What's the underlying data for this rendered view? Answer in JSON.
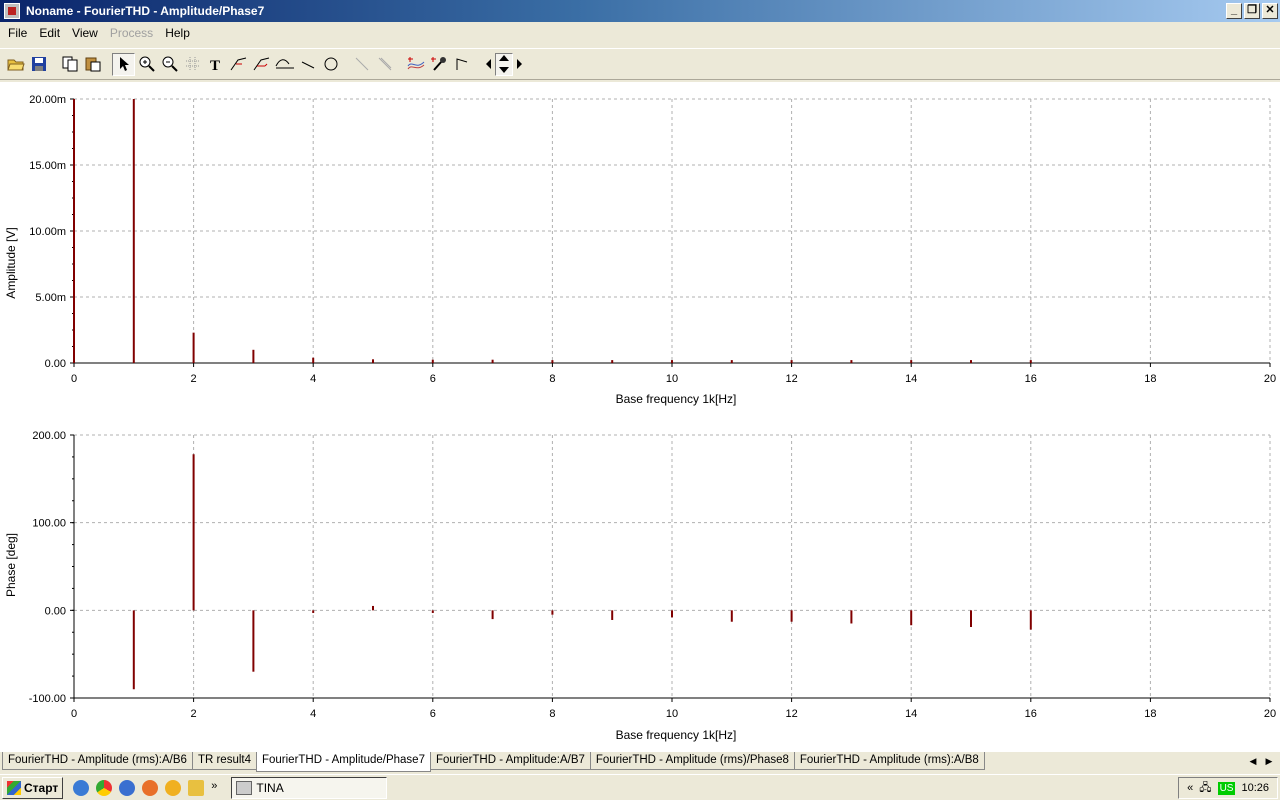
{
  "window": {
    "title": "Noname - FourierTHD - Amplitude/Phase7"
  },
  "menu": [
    "File",
    "Edit",
    "View",
    "Process",
    "Help"
  ],
  "toolbar_icons": [
    "open-icon",
    "save-icon",
    "copy-icon",
    "paste-icon",
    "pointer-icon",
    "zoom-in-icon",
    "zoom-out-icon",
    "grid-icon",
    "text-icon",
    "curve-marker-icon",
    "curve-marker-2-icon",
    "axis-marker-icon",
    "line-icon",
    "circle-icon",
    "diag-line-icon",
    "diag-line-2-icon",
    "add-curve-icon",
    "pick-color-icon",
    "cursor-icon",
    "arrow-left-icon",
    "arrow-updown-icon",
    "arrow-right-icon"
  ],
  "chart_data": [
    {
      "type": "bar",
      "ylabel": "Amplitude [V]",
      "xlabel": "Base frequency 1k[Hz]",
      "xlim": [
        0,
        20
      ],
      "ylim": [
        0,
        0.02
      ],
      "grid": true,
      "color": "#800000",
      "x_ticks": [
        "0",
        "2",
        "4",
        "6",
        "8",
        "10",
        "12",
        "14",
        "16",
        "18",
        "20"
      ],
      "y_ticks": [
        "0.00",
        "5.00m",
        "10.00m",
        "15.00m",
        "20.00m"
      ],
      "x": [
        0,
        1,
        2,
        3,
        4,
        5,
        6,
        7,
        8,
        9,
        10,
        11,
        12,
        13,
        14,
        15,
        16
      ],
      "values": [
        0.02,
        0.02,
        0.0023,
        0.001,
        0.0004,
        0.00028,
        0.00025,
        0.00025,
        0.00022,
        0.00022,
        0.00022,
        0.00022,
        0.00022,
        0.00022,
        0.00022,
        0.00022,
        0.00022
      ]
    },
    {
      "type": "bar",
      "ylabel": "Phase [deg]",
      "xlabel": "Base frequency 1k[Hz]",
      "xlim": [
        0,
        20
      ],
      "ylim": [
        -100,
        200
      ],
      "grid": true,
      "color": "#800000",
      "x_ticks": [
        "0",
        "2",
        "4",
        "6",
        "8",
        "10",
        "12",
        "14",
        "16",
        "18",
        "20"
      ],
      "y_ticks": [
        "-100.00",
        "0.00",
        "100.00",
        "200.00"
      ],
      "x": [
        1,
        2,
        3,
        4,
        5,
        6,
        7,
        8,
        9,
        10,
        11,
        12,
        13,
        14,
        15,
        16
      ],
      "values": [
        -90,
        178,
        -70,
        -3,
        5,
        -3,
        -10,
        -5,
        -11,
        -8,
        -13,
        -13,
        -15,
        -17,
        -19,
        -22
      ]
    }
  ],
  "tabs": [
    {
      "label": "FourierTHD - Amplitude (rms):A/B6",
      "active": false
    },
    {
      "label": "TR result4",
      "active": false
    },
    {
      "label": "FourierTHD - Amplitude/Phase7",
      "active": true
    },
    {
      "label": "FourierTHD - Amplitude:A/B7",
      "active": false
    },
    {
      "label": "FourierTHD - Amplitude (rms)/Phase8",
      "active": false
    },
    {
      "label": "FourierTHD - Amplitude (rms):A/B8",
      "active": false
    }
  ],
  "taskbar": {
    "start_label": "Старт",
    "task_label": "TINA",
    "lang": "US",
    "clock": "10:26"
  }
}
